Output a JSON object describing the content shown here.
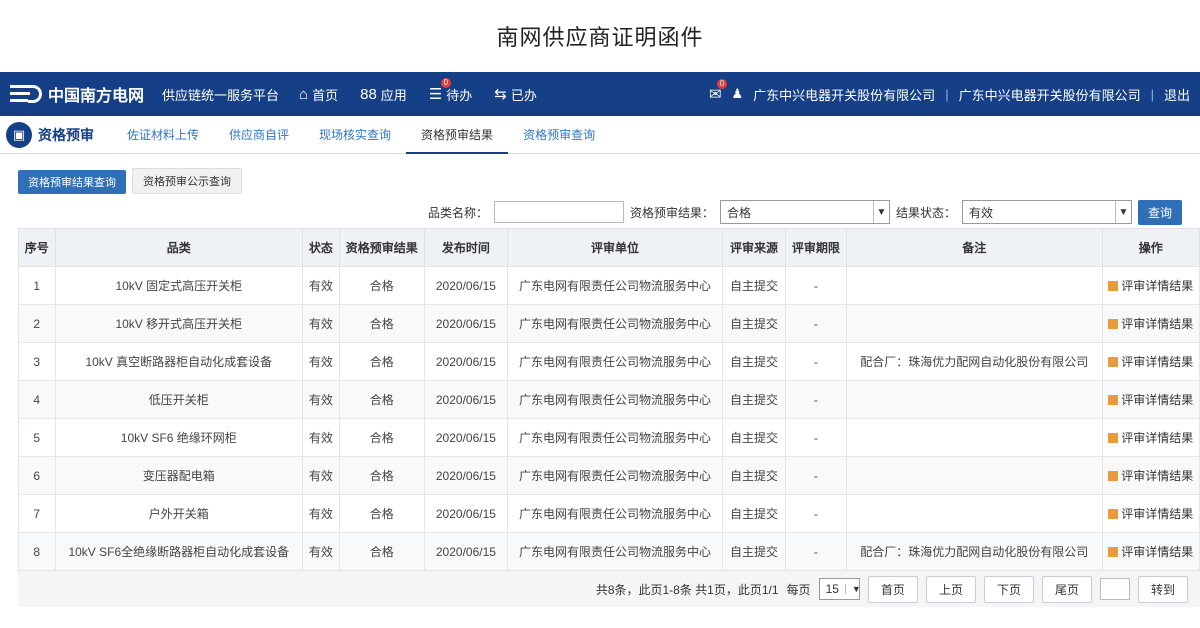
{
  "page_title": "南网供应商证明函件",
  "topbar": {
    "logo_text": "中国南方电网",
    "platform": "供应链统一服务平台",
    "nav": [
      {
        "icon": "home-icon",
        "glyph": "⌂",
        "label": "首页"
      },
      {
        "icon": "apps-icon",
        "glyph": "88",
        "label": "应用"
      },
      {
        "icon": "todo-icon",
        "glyph": "☰",
        "label": "待办",
        "badge": "0"
      },
      {
        "icon": "done-icon",
        "glyph": "⇆",
        "label": "已办"
      }
    ],
    "mail_badge": "0",
    "company1": "广东中兴电器开关股份有限公司",
    "company2": "广东中兴电器开关股份有限公司",
    "logout": "退出"
  },
  "subnav": {
    "home_label": "资格预审",
    "tabs": [
      "佐证材料上传",
      "供应商自评",
      "现场核实查询",
      "资格预审结果",
      "资格预审查询"
    ],
    "active_index": 3
  },
  "buttons": {
    "tab1": "资格预审结果查询",
    "tab2": "资格预审公示查询"
  },
  "filter": {
    "category_label": "品类名称：",
    "category_value": "",
    "result_label": "资格预审结果：",
    "result_value": "合格",
    "status_label": "结果状态：",
    "status_value": "有效",
    "query_button": "查询"
  },
  "table": {
    "headers": [
      "序号",
      "品类",
      "状态",
      "资格预审结果",
      "发布时间",
      "评审单位",
      "评审来源",
      "评审期限",
      "备注",
      "操作"
    ],
    "rows": [
      [
        "1",
        "10kV 固定式高压开关柜",
        "有效",
        "合格",
        "2020/06/15",
        "广东电网有限责任公司物流服务中心",
        "自主提交",
        "-",
        "",
        "评审详情结果"
      ],
      [
        "2",
        "10kV 移开式高压开关柜",
        "有效",
        "合格",
        "2020/06/15",
        "广东电网有限责任公司物流服务中心",
        "自主提交",
        "-",
        "",
        "评审详情结果"
      ],
      [
        "3",
        "10kV 真空断路器柜自动化成套设备",
        "有效",
        "合格",
        "2020/06/15",
        "广东电网有限责任公司物流服务中心",
        "自主提交",
        "-",
        "配合厂：珠海优力配网自动化股份有限公司",
        "评审详情结果"
      ],
      [
        "4",
        "低压开关柜",
        "有效",
        "合格",
        "2020/06/15",
        "广东电网有限责任公司物流服务中心",
        "自主提交",
        "-",
        "",
        "评审详情结果"
      ],
      [
        "5",
        "10kV SF6 绝缘环网柜",
        "有效",
        "合格",
        "2020/06/15",
        "广东电网有限责任公司物流服务中心",
        "自主提交",
        "-",
        "",
        "评审详情结果"
      ],
      [
        "6",
        "变压器配电箱",
        "有效",
        "合格",
        "2020/06/15",
        "广东电网有限责任公司物流服务中心",
        "自主提交",
        "-",
        "",
        "评审详情结果"
      ],
      [
        "7",
        "户外开关箱",
        "有效",
        "合格",
        "2020/06/15",
        "广东电网有限责任公司物流服务中心",
        "自主提交",
        "-",
        "",
        "评审详情结果"
      ],
      [
        "8",
        "10kV SF6全绝缘断路器柜自动化成套设备",
        "有效",
        "合格",
        "2020/06/15",
        "广东电网有限责任公司物流服务中心",
        "自主提交",
        "-",
        "配合厂：珠海优力配网自动化股份有限公司",
        "评审详情结果"
      ]
    ]
  },
  "pager": {
    "summary": "共8条，此页1-8条 共1页，此页1/1",
    "per_page_label": "每页",
    "per_page_value": "15",
    "first": "首页",
    "prev": "上页",
    "next": "下页",
    "last": "尾页",
    "go": "转到"
  },
  "colors": {
    "topbar": "#153f86",
    "primary_button": "#2f6fb8",
    "badge": "#e73b3b"
  }
}
